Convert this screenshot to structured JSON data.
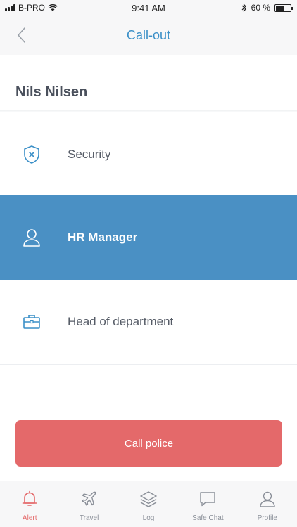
{
  "status_bar": {
    "carrier": "B-PRO",
    "time": "9:41 AM",
    "battery_text": "60 %",
    "battery_level": 0.6
  },
  "nav": {
    "title": "Call-out",
    "back_icon": "chevron-left-icon"
  },
  "contact": {
    "name": "Nils Nilsen"
  },
  "options": [
    {
      "label": "Security",
      "icon": "shield-icon",
      "selected": false
    },
    {
      "label": "HR Manager",
      "icon": "person-icon",
      "selected": true
    },
    {
      "label": "Head of department",
      "icon": "briefcase-icon",
      "selected": false
    }
  ],
  "call_button": {
    "label": "Call police"
  },
  "tabs": [
    {
      "label": "Alert",
      "icon": "bell-icon",
      "active": true
    },
    {
      "label": "Travel",
      "icon": "airplane-icon",
      "active": false
    },
    {
      "label": "Log",
      "icon": "layers-icon",
      "active": false
    },
    {
      "label": "Safe Chat",
      "icon": "chat-bubble-icon",
      "active": false
    },
    {
      "label": "Profile",
      "icon": "person-icon",
      "active": false
    }
  ],
  "colors": {
    "accent_blue": "#3a8fc7",
    "selected_row": "#4a90c4",
    "alert_red": "#e4696a",
    "icon_blue": "#3a8fc7",
    "tab_gray": "#8a8f98"
  }
}
